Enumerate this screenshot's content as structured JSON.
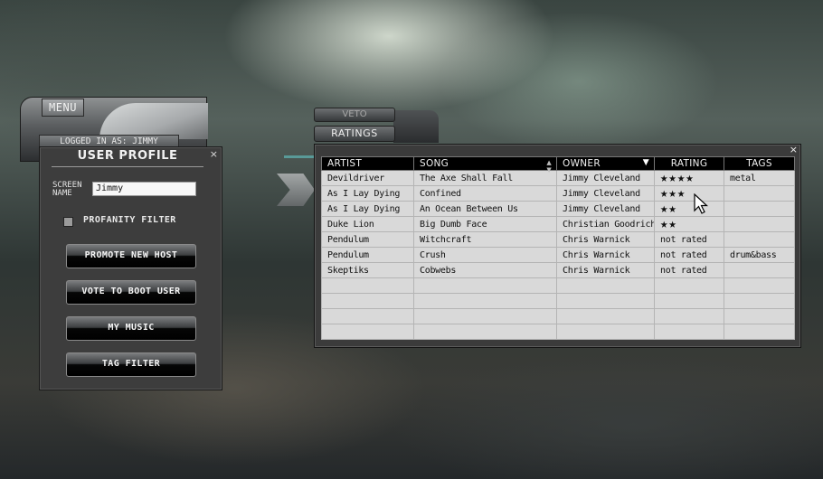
{
  "left_panel": {
    "menu_label": "MENU",
    "logged_in": "LOGGED IN AS: JIMMY",
    "title": "USER PROFILE",
    "close_glyph": "×",
    "screen_name_label_1": "SCREEN",
    "screen_name_label_2": "NAME",
    "screen_name_value": "Jimmy",
    "profanity_filter_label": "PROFANITY FILTER",
    "profanity_filter_checked": false,
    "buttons": [
      "PROMOTE NEW HOST",
      "VOTE TO BOOT USER",
      "MY MUSIC",
      "TAG FILTER"
    ]
  },
  "center": {
    "veto_label": "VETO",
    "ratings_label": "RATINGS"
  },
  "table": {
    "close_glyph": "×",
    "headers": [
      "ARTIST",
      "SONG",
      "OWNER",
      "RATING",
      "TAGS"
    ],
    "sort_icon": "sort-arrows-icon",
    "dropdown_icon": "dropdown-arrow-icon",
    "rows": [
      {
        "artist": "Devildriver",
        "song": "The Axe Shall Fall",
        "owner": "Jimmy Cleveland",
        "rating": "★★★★",
        "rating_value": 4,
        "tags": "metal"
      },
      {
        "artist": "As I Lay Dying",
        "song": "Confined",
        "owner": "Jimmy Cleveland",
        "rating": "★★★",
        "rating_value": 3,
        "tags": ""
      },
      {
        "artist": "As I Lay Dying",
        "song": "An Ocean Between Us",
        "owner": "Jimmy Cleveland",
        "rating": "★★",
        "rating_value": 2,
        "tags": ""
      },
      {
        "artist": "Duke Lion",
        "song": "Big Dumb Face",
        "owner": "Christian Goodrich",
        "rating": "★★",
        "rating_value": 2,
        "tags": ""
      },
      {
        "artist": "Pendulum",
        "song": "Witchcraft",
        "owner": "Chris Warnick",
        "rating": "not rated",
        "rating_value": null,
        "tags": ""
      },
      {
        "artist": "Pendulum",
        "song": "Crush",
        "owner": "Chris Warnick",
        "rating": "not rated",
        "rating_value": null,
        "tags": "drum&bass"
      },
      {
        "artist": "Skeptiks",
        "song": "Cobwebs",
        "owner": "Chris Warnick",
        "rating": "not rated",
        "rating_value": null,
        "tags": ""
      }
    ],
    "empty_rows": 4
  }
}
